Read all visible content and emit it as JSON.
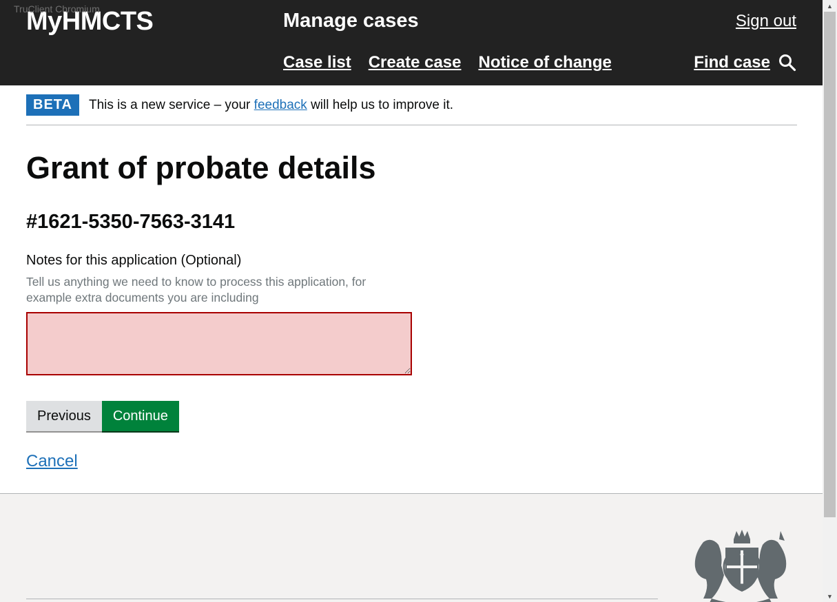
{
  "window": {
    "overlay_label": "TruClient Chromium"
  },
  "header": {
    "brand": "MyHMCTS",
    "service_name": "Manage cases",
    "sign_out": "Sign out",
    "nav": [
      "Case list",
      "Create case",
      "Notice of change"
    ],
    "find_case": "Find case",
    "search_icon": "search-icon"
  },
  "beta": {
    "tag": "BETA",
    "text_before": "This is a new service – your ",
    "link": "feedback",
    "text_after": " will help us to improve it."
  },
  "main": {
    "title": "Grant of probate details",
    "case_reference": "#1621-5350-7563-3141",
    "notes_label": "Notes for this application (Optional)",
    "notes_hint": "Tell us anything we need to know to process this application, for example extra documents you are including",
    "notes_value": "",
    "previous_label": "Previous",
    "continue_label": "Continue",
    "cancel_label": "Cancel"
  },
  "footer": {
    "crest_icon": "royal-coat-of-arms-icon"
  },
  "colors": {
    "header_bg": "#222222",
    "beta_tag": "#1d70b8",
    "link": "#1d70b8",
    "error_border": "#a80000",
    "error_fill": "#f4cccc",
    "continue_button": "#00823b",
    "previous_button": "#dee0e2",
    "footer_bg": "#f3f2f1"
  }
}
